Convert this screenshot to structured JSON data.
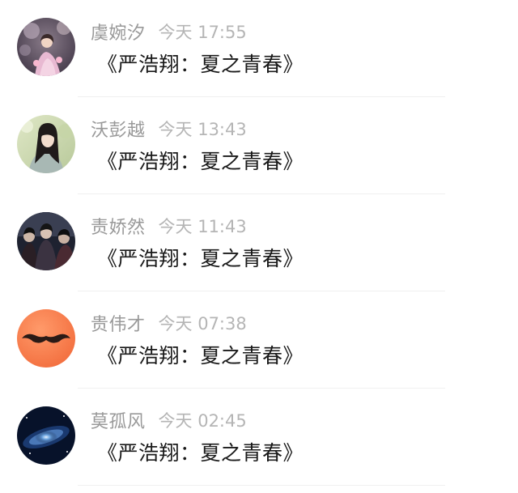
{
  "comments": [
    {
      "name": "虞婉汐",
      "day": "今天",
      "time": "17:55",
      "message": "《严浩翔：夏之青春》",
      "avatar_icon": "girl-in-pink-dress-avatar"
    },
    {
      "name": "沃彭越",
      "day": "今天",
      "time": "13:43",
      "message": "《严浩翔：夏之青春》",
      "avatar_icon": "girl-outdoors-avatar"
    },
    {
      "name": "责娇然",
      "day": "今天",
      "time": "11:43",
      "message": "《严浩翔：夏之青春》",
      "avatar_icon": "group-of-men-avatar"
    },
    {
      "name": "贵伟才",
      "day": "今天",
      "time": "07:38",
      "message": "《严浩翔：夏之青春》",
      "avatar_icon": "orange-mustache-avatar"
    },
    {
      "name": "莫孤风",
      "day": "今天",
      "time": "02:45",
      "message": "《严浩翔：夏之青春》",
      "avatar_icon": "galaxy-avatar"
    }
  ],
  "colors": {
    "name_text": "#999999",
    "time_text": "#b5b5b5",
    "message_text": "#1a1a1a",
    "divider": "#f0f0f0"
  }
}
